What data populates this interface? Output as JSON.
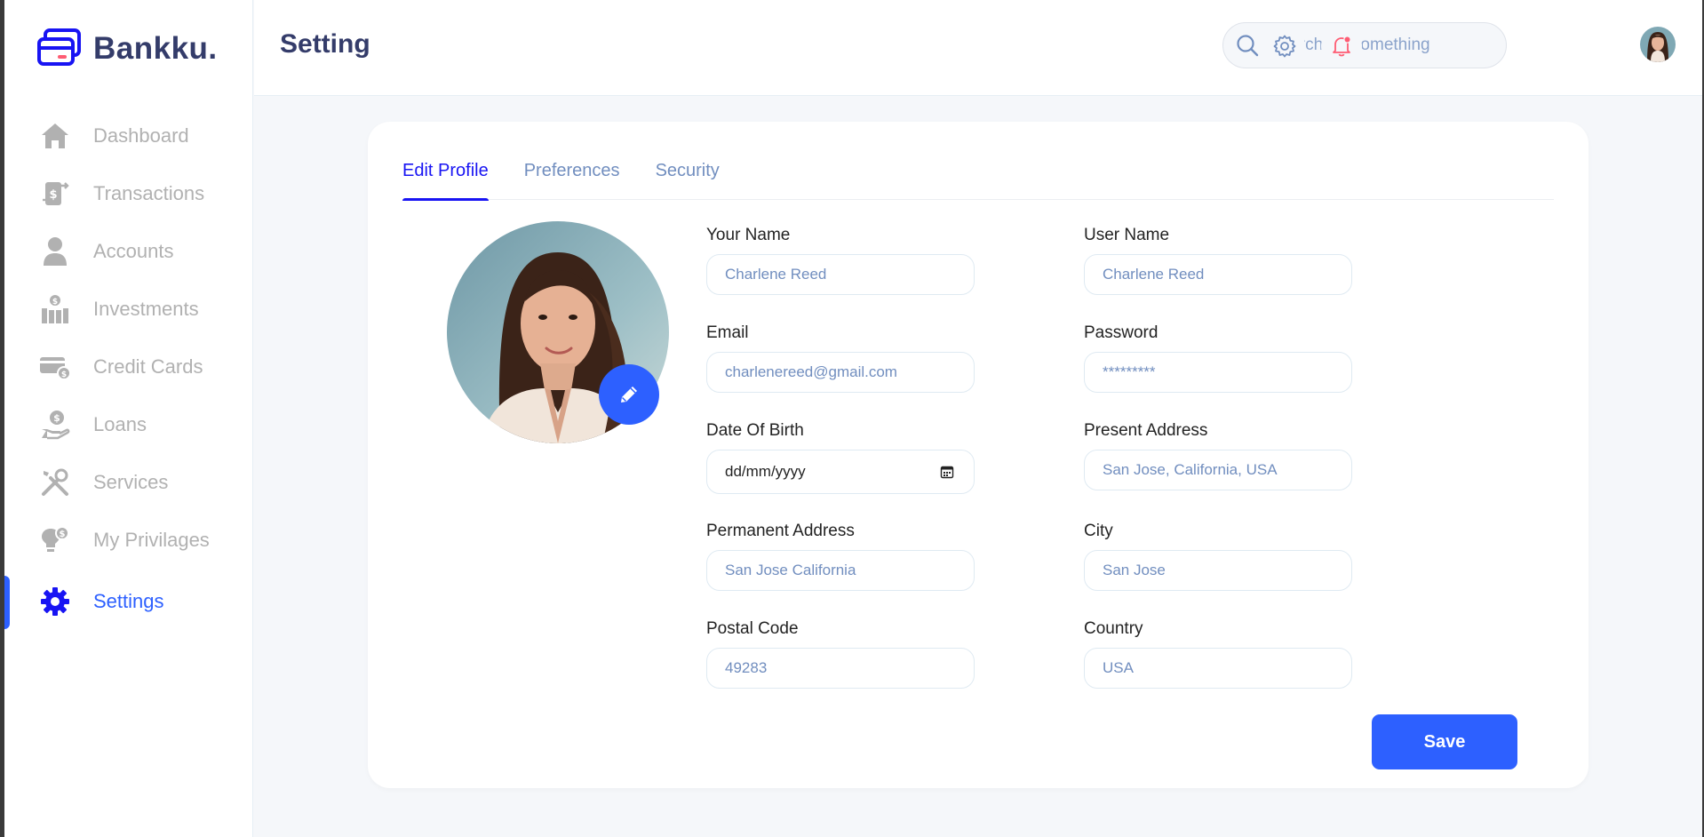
{
  "brand": {
    "name": "Bankku."
  },
  "sidebar": {
    "items": [
      {
        "label": "Dashboard",
        "icon": "home-icon",
        "active": false
      },
      {
        "label": "Transactions",
        "icon": "transfer-icon",
        "active": false
      },
      {
        "label": "Accounts",
        "icon": "user-icon",
        "active": false
      },
      {
        "label": "Investments",
        "icon": "investment-icon",
        "active": false
      },
      {
        "label": "Credit Cards",
        "icon": "credit-card-icon",
        "active": false
      },
      {
        "label": "Loans",
        "icon": "loan-icon",
        "active": false
      },
      {
        "label": "Services",
        "icon": "services-icon",
        "active": false
      },
      {
        "label": "My Privilages",
        "icon": "privilege-icon",
        "active": false
      },
      {
        "label": "Settings",
        "icon": "gear-icon",
        "active": true
      }
    ]
  },
  "header": {
    "title": "Setting",
    "search_placeholder": "Search for something"
  },
  "tabs": [
    {
      "label": "Edit Profile",
      "active": true
    },
    {
      "label": "Preferences",
      "active": false
    },
    {
      "label": "Security",
      "active": false
    }
  ],
  "form": {
    "your_name": {
      "label": "Your Name",
      "value": "Charlene Reed"
    },
    "user_name": {
      "label": "User Name",
      "value": "Charlene Reed"
    },
    "email": {
      "label": "Email",
      "value": "charlenereed@gmail.com"
    },
    "password": {
      "label": "Password",
      "value": "*********"
    },
    "dob": {
      "label": "Date Of Birth",
      "value": "dd/mm/yyyy"
    },
    "present_address": {
      "label": "Present Address",
      "value": "San Jose, California, USA"
    },
    "permanent_address": {
      "label": "Permanent Address",
      "value": "San Jose California"
    },
    "city": {
      "label": "City",
      "value": "San Jose"
    },
    "postal_code": {
      "label": "Postal Code",
      "value": "49283"
    },
    "country": {
      "label": "Country",
      "value": "USA"
    }
  },
  "actions": {
    "save_label": "Save"
  },
  "colors": {
    "primary": "#2d60ff",
    "active_tab": "#1814f3",
    "title": "#343c6a",
    "muted": "#b1b1b1",
    "input_text": "#718ebf",
    "notification": "#fe5c73"
  }
}
